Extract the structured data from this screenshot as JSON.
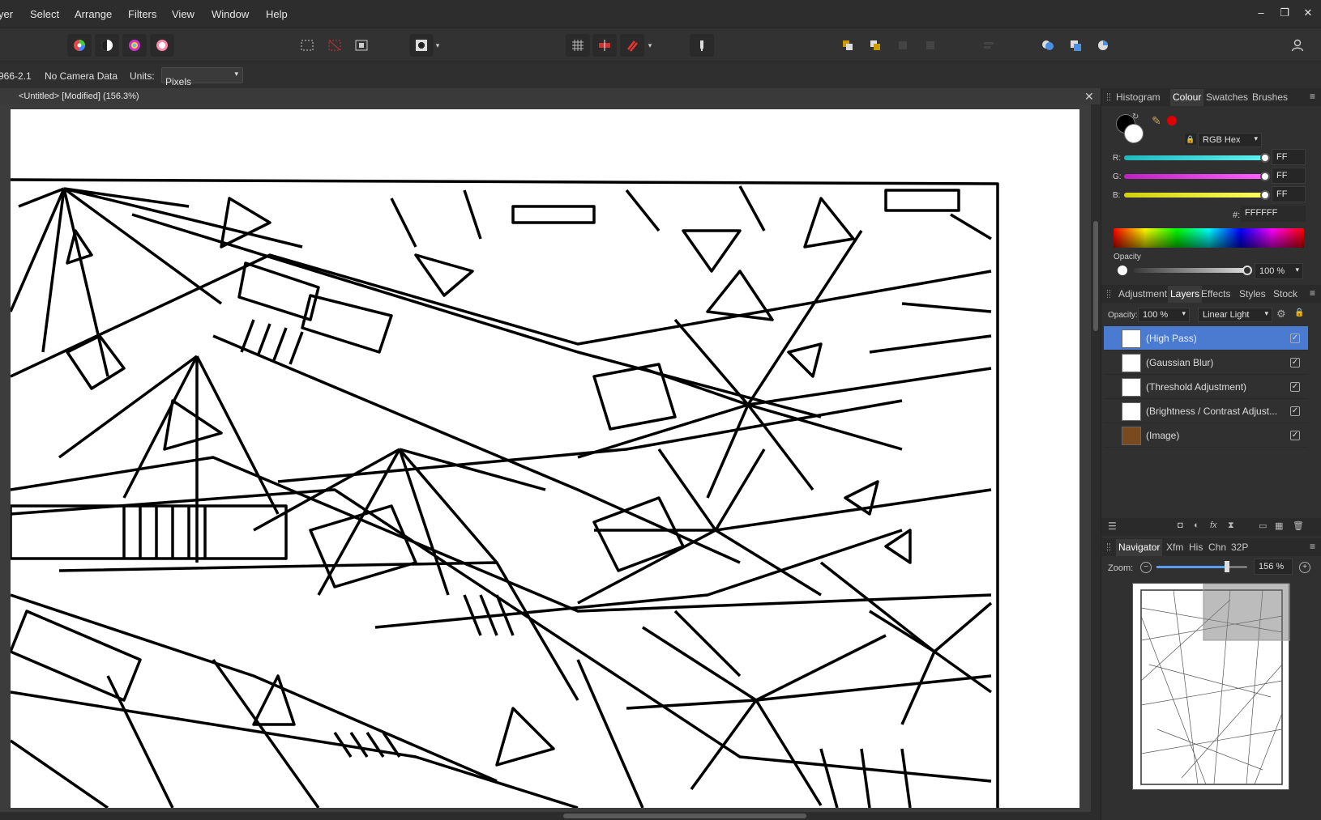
{
  "menu": {
    "partial_left": "yer",
    "items": [
      "Select",
      "Arrange",
      "Filters",
      "View",
      "Window",
      "Help"
    ]
  },
  "window_controls": {
    "minimize": "–",
    "restore": "❐",
    "close": "✕"
  },
  "context_bar": {
    "camera_id": "966-2.1",
    "camera_data": "No Camera Data",
    "units_label": "Units:",
    "units_value": "Pixels"
  },
  "document": {
    "tab_title": "<Untitled> [Modified] (156.3%)",
    "close": "✕"
  },
  "colour_panel": {
    "tabs": [
      "Histogram",
      "Colour",
      "Swatches",
      "Brushes"
    ],
    "active_tab": "Colour",
    "mode": "RGB Hex",
    "channels": [
      {
        "label": "R:",
        "value": "FF"
      },
      {
        "label": "G:",
        "value": "FF"
      },
      {
        "label": "B:",
        "value": "FF"
      }
    ],
    "hex_label": "#:",
    "hex_value": "FFFFFF",
    "opacity_label": "Opacity",
    "opacity_value": "100 %",
    "colors": {
      "r": "#40e0e8",
      "g": "#e040e0",
      "b": "#f0f020",
      "accent": "#e00000"
    }
  },
  "layers_panel": {
    "tabs": [
      "Adjustment",
      "Layers",
      "Effects",
      "Styles",
      "Stock"
    ],
    "active_tab": "Layers",
    "opacity_label": "Opacity:",
    "opacity_value": "100 %",
    "blend_mode": "Linear Light",
    "layers": [
      {
        "name": "(High Pass)",
        "selected": true
      },
      {
        "name": "(Gaussian Blur)",
        "selected": false
      },
      {
        "name": "(Threshold Adjustment)",
        "selected": false
      },
      {
        "name": "(Brightness / Contrast Adjust...",
        "selected": false
      },
      {
        "name": "(Image)",
        "selected": false
      }
    ]
  },
  "navigator_panel": {
    "tabs": [
      "Navigator",
      "Xfm",
      "His",
      "Chn",
      "32P"
    ],
    "active_tab": "Navigator",
    "zoom_label": "Zoom:",
    "zoom_value": "156 %",
    "zoom_fraction": 0.78
  }
}
